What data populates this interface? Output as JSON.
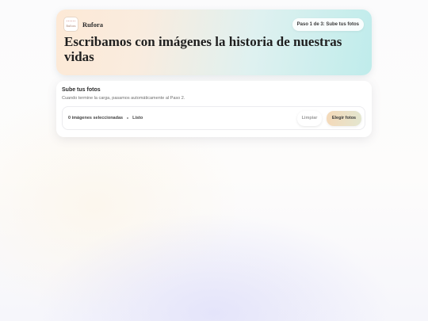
{
  "brand": {
    "name": "Rufora",
    "logo_text": "Rufora",
    "logo_icon": "rufora-logo"
  },
  "header": {
    "step_badge": "Paso 1 de 3: Sube tus fotos",
    "title": "Escribamos con imágenes la historia de nuestras vidas"
  },
  "upload": {
    "title": "Sube tus fotos",
    "subtitle": "Cuando termine la carga, pasamos automáticamente al Paso 2.",
    "count_text": "0 imágenes seleccionadas",
    "status_text": "Listo",
    "clear_label": "Limpiar",
    "choose_label": "Elegir fotos"
  },
  "colors": {
    "hero_gradient_start": "#fde9d6",
    "hero_gradient_end": "#bfeceb",
    "choose_button_start": "#f4d9b9",
    "choose_button_end": "#e3e6cf"
  }
}
